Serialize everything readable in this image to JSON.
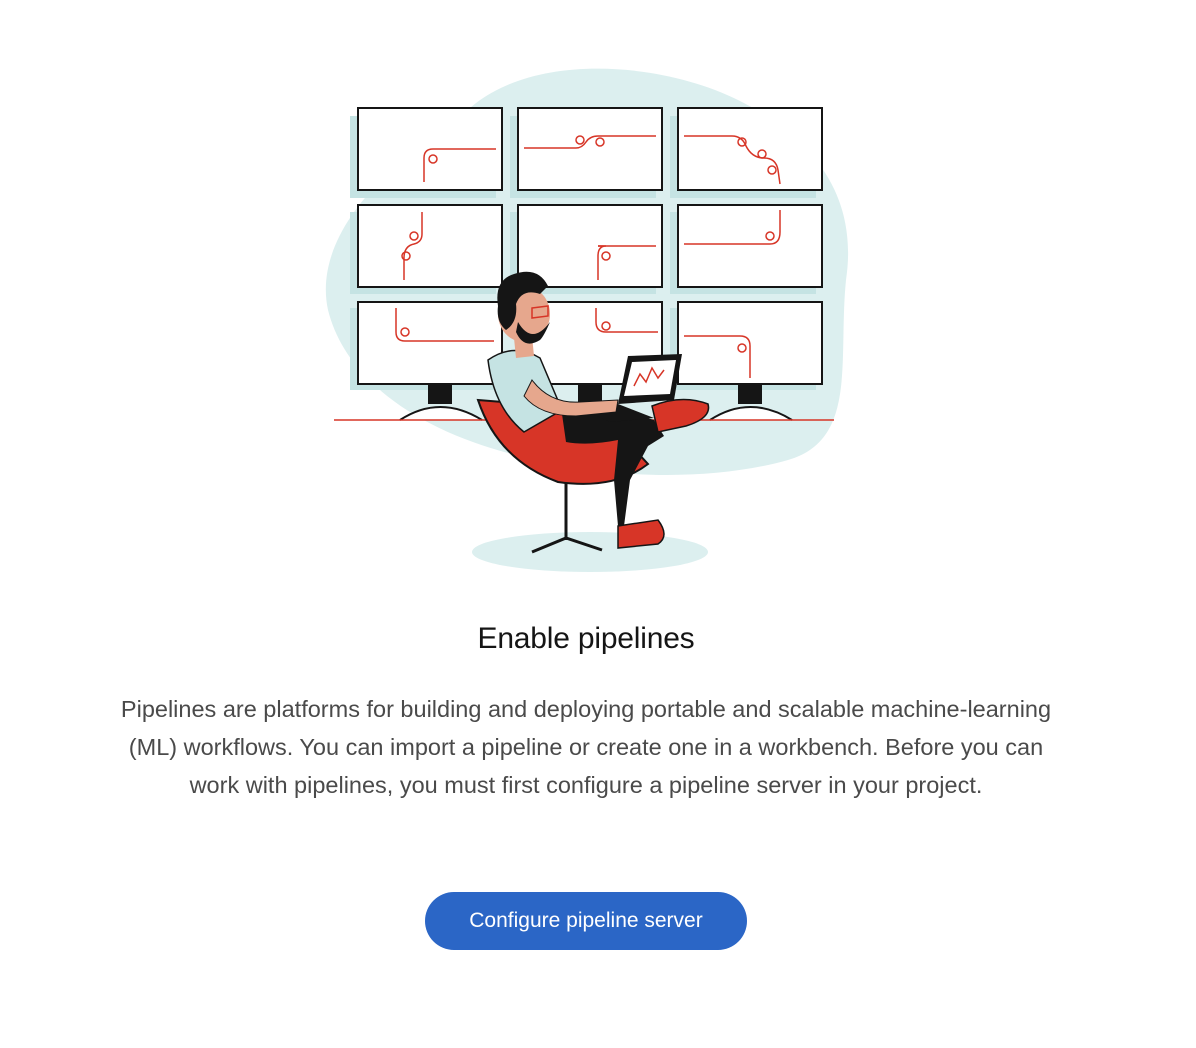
{
  "empty_state": {
    "title": "Enable pipelines",
    "description": "Pipelines are platforms for building and deploying portable and scalable machine-learning (ML) workflows. You can import a pipeline or create one in a workbench. Before you can work with pipelines, you must first configure a pipeline server in your project.",
    "primary_action_label": "Configure pipeline server"
  },
  "colors": {
    "accent_blue": "#2b66c6",
    "illustration_red": "#d73527",
    "blob_teal": "#dcefef",
    "title_text": "#151515",
    "body_text": "#4a4a4a"
  },
  "icons": [
    "pipelines-illustration"
  ]
}
